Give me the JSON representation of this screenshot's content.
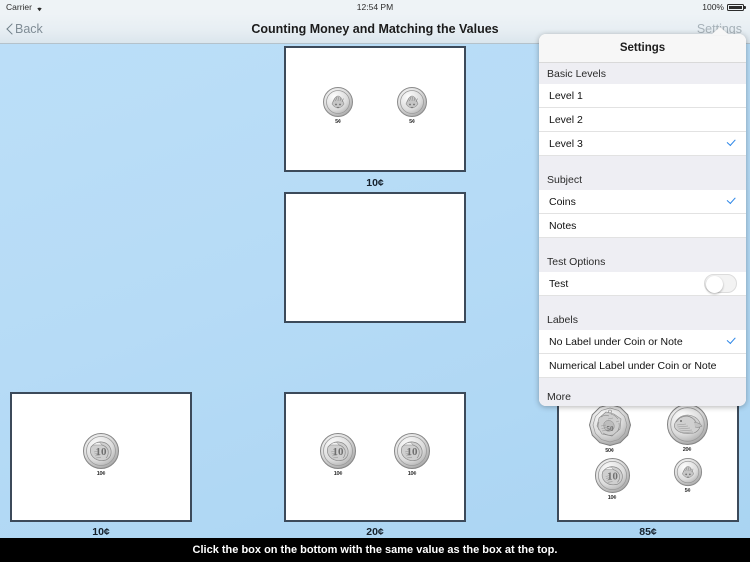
{
  "status_bar": {
    "carrier": "Carrier",
    "wifi_icon": "wifi-icon",
    "time": "12:54 PM",
    "battery_percent": "100%",
    "battery_icon": "battery-full-icon"
  },
  "nav_bar": {
    "back_label": "Back",
    "back_icon": "chevron-left-icon",
    "title": "Counting Money and Matching the Values",
    "settings_label": "Settings"
  },
  "settings_popover": {
    "title": "Settings",
    "sections": [
      {
        "header": "Basic Levels",
        "rows": [
          {
            "label": "Level 1",
            "checked": false
          },
          {
            "label": "Level 2",
            "checked": false
          },
          {
            "label": "Level 3",
            "checked": true
          }
        ]
      },
      {
        "header": "Subject",
        "rows": [
          {
            "label": "Coins",
            "checked": true
          },
          {
            "label": "Notes",
            "checked": false
          }
        ]
      },
      {
        "header": "Test Options",
        "rows": [
          {
            "label": "Test",
            "toggle": true,
            "toggle_on": false
          }
        ]
      },
      {
        "header": "Labels",
        "rows": [
          {
            "label": "No Label under Coin or Note",
            "checked": true
          },
          {
            "label": "Numerical Label under Coin or Note",
            "checked": false
          }
        ]
      }
    ],
    "more_header": "More",
    "check_color": "#2d87e8"
  },
  "question_box": {
    "caption": "10¢",
    "coins": [
      {
        "value": "5¢",
        "type": "5c"
      },
      {
        "value": "5¢",
        "type": "5c"
      }
    ]
  },
  "answer_slot": {
    "caption": "",
    "coins": []
  },
  "choice_boxes": [
    {
      "caption": "10¢",
      "coins": [
        {
          "value": "10¢",
          "type": "10c"
        }
      ]
    },
    {
      "caption": "20¢",
      "coins": [
        {
          "value": "10¢",
          "type": "10c"
        },
        {
          "value": "10¢",
          "type": "10c"
        }
      ]
    },
    {
      "caption": "85¢",
      "coins": [
        {
          "value": "50¢",
          "type": "50c"
        },
        {
          "value": "20¢",
          "type": "20c"
        },
        {
          "value": "10¢",
          "type": "10c"
        },
        {
          "value": "5¢",
          "type": "5c"
        }
      ]
    }
  ],
  "footer": {
    "instruction": "Click the box on the bottom with the same value as the box at the top."
  },
  "colors": {
    "background_top": "#bcdff8",
    "background_bottom": "#a9d4f2",
    "box_border": "#3c4a5a",
    "footer_background": "#000000",
    "accent_blue": "#2d87e8"
  }
}
